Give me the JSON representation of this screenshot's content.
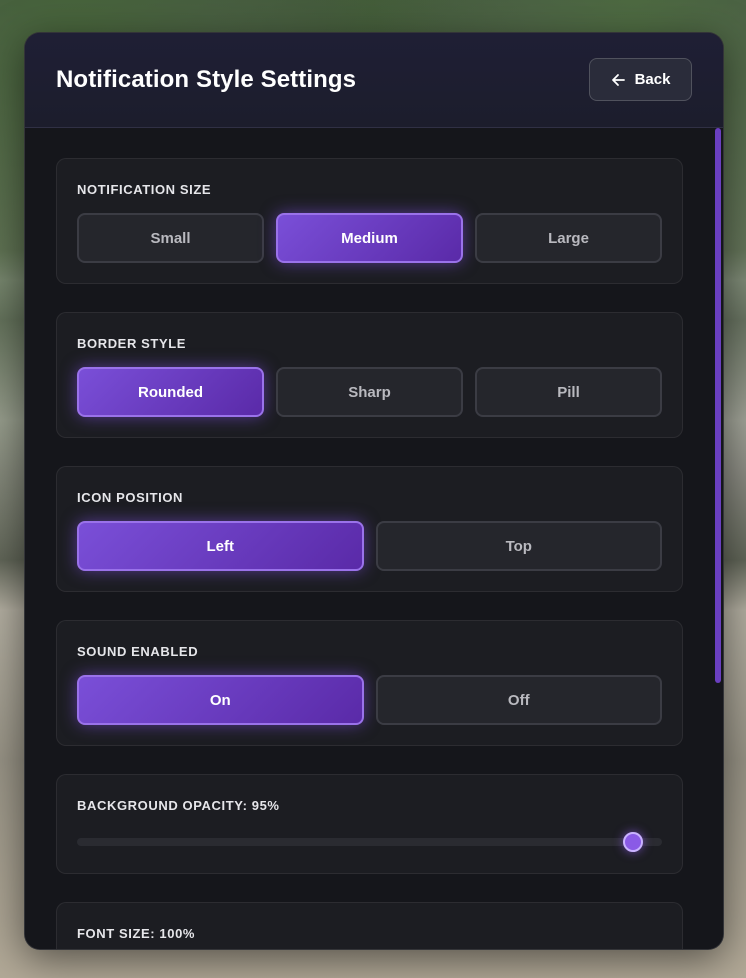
{
  "panel": {
    "title": "Notification Style Settings",
    "back_label": "Back"
  },
  "sections": {
    "size": {
      "label": "NOTIFICATION SIZE",
      "options": [
        "Small",
        "Medium",
        "Large"
      ],
      "selected": "Medium"
    },
    "border": {
      "label": "BORDER STYLE",
      "options": [
        "Rounded",
        "Sharp",
        "Pill"
      ],
      "selected": "Rounded"
    },
    "icon_position": {
      "label": "ICON POSITION",
      "options": [
        "Left",
        "Top"
      ],
      "selected": "Left"
    },
    "sound": {
      "label": "SOUND ENABLED",
      "options": [
        "On",
        "Off"
      ],
      "selected": "On"
    },
    "opacity": {
      "label": "BACKGROUND OPACITY: 95%",
      "value_fraction": 0.95
    },
    "font_size": {
      "label": "FONT SIZE: 100%"
    }
  },
  "colors": {
    "accent": "#7a4fd8",
    "panel_bg": "#17181d"
  },
  "icons": {
    "back": "arrow-left-icon"
  }
}
